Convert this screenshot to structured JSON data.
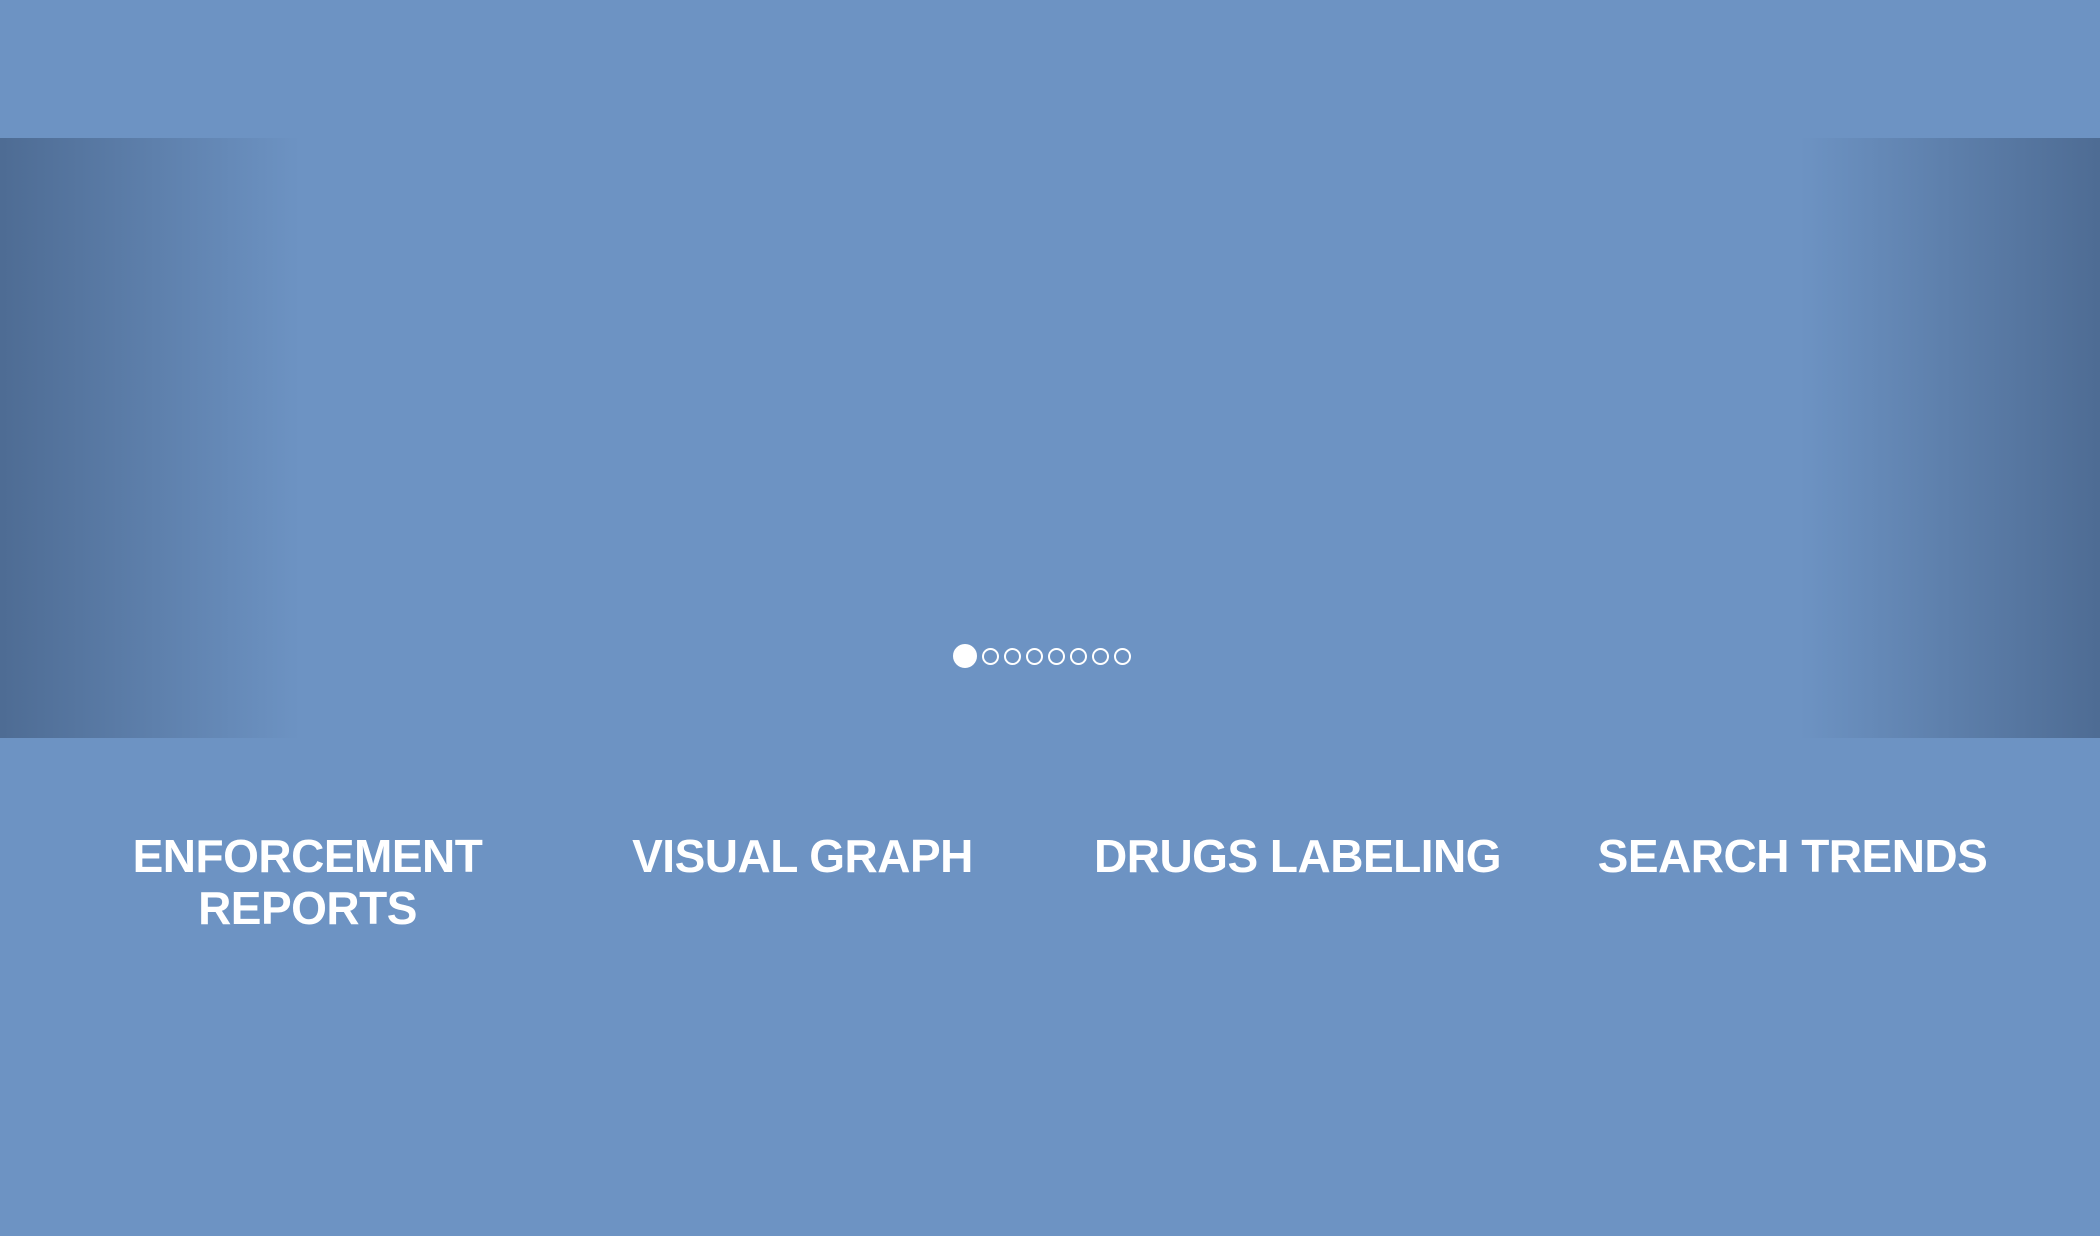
{
  "colors": {
    "background": "#6d93c3",
    "text": "#ffffff",
    "side_shade": "#4a6890"
  },
  "carousel": {
    "slide_count": 8,
    "active_index": 0
  },
  "features": [
    {
      "label": "ENFORCEMENT REPORTS"
    },
    {
      "label": "VISUAL GRAPH"
    },
    {
      "label": "DRUGS LABELING"
    },
    {
      "label": "SEARCH TRENDS"
    }
  ]
}
